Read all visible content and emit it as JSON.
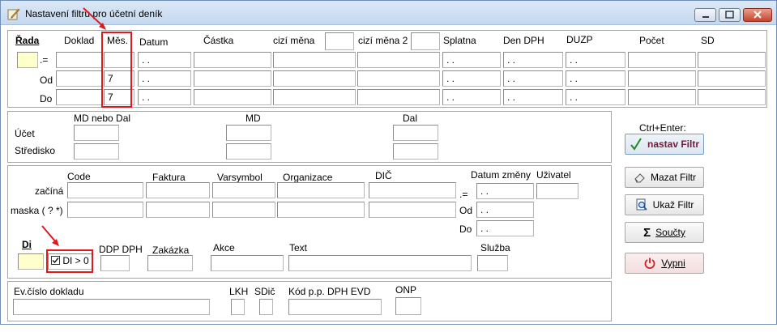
{
  "window": {
    "title": "Nastavení filtru pro účetní deník"
  },
  "row_header": {
    "rada": "Řada",
    "doklad": "Doklad",
    "mes": "Měs.",
    "datum": "Datum",
    "castka": "Částka",
    "cizi_mena": "cizí měna",
    "cizi_mena2": "cizí měna 2",
    "splatna": "Splatna",
    "den_dph": "Den DPH",
    "duzp": "DUZP",
    "pocet": "Počet",
    "sd": "SD"
  },
  "row_labels": {
    "eq": ".=",
    "od": "Od",
    "do": "Do"
  },
  "date_placeholder": ". .",
  "values": {
    "mes_od": "7",
    "mes_do": "7"
  },
  "account": {
    "md_nebo_dal": "MD nebo Dal",
    "md": "MD",
    "dal": "Dal",
    "ucet": "Účet",
    "stredisko": "Středisko"
  },
  "codes": {
    "code": "Code",
    "faktura": "Faktura",
    "varsymbol": "Varsymbol",
    "organizace": "Organizace",
    "dic": "DIČ",
    "datum_zmeny": "Datum změny",
    "uzivatel": "Uživatel",
    "zacina": "začíná",
    "maska": "maska ( ? *)",
    "eq": ".=",
    "od": "Od",
    "do": "Do"
  },
  "di_row": {
    "di": "Di",
    "checkbox_label": "DI > 0",
    "ddp_dph": "DDP DPH",
    "zakazka": "Zakázka",
    "akce": "Akce",
    "text": "Text",
    "sluzba": "Služba"
  },
  "bottom": {
    "evcislo": "Ev.číslo dokladu",
    "lkh": "LKH",
    "sdic": "SDič",
    "kod": "Kód p.p. DPH EVD",
    "onp": "ONP"
  },
  "buttons": {
    "hint": "Ctrl+Enter:",
    "nastav": "nastav Filtr",
    "mazat": "Mazat Filtr",
    "ukaz": "Ukaž Filtr",
    "soucty": "Součty",
    "vypni": "Vypni"
  },
  "colors": {
    "annotation_red": "#e0191c",
    "nastav_text": "#6b1f3a",
    "yellow_field": "#ffffcc"
  }
}
